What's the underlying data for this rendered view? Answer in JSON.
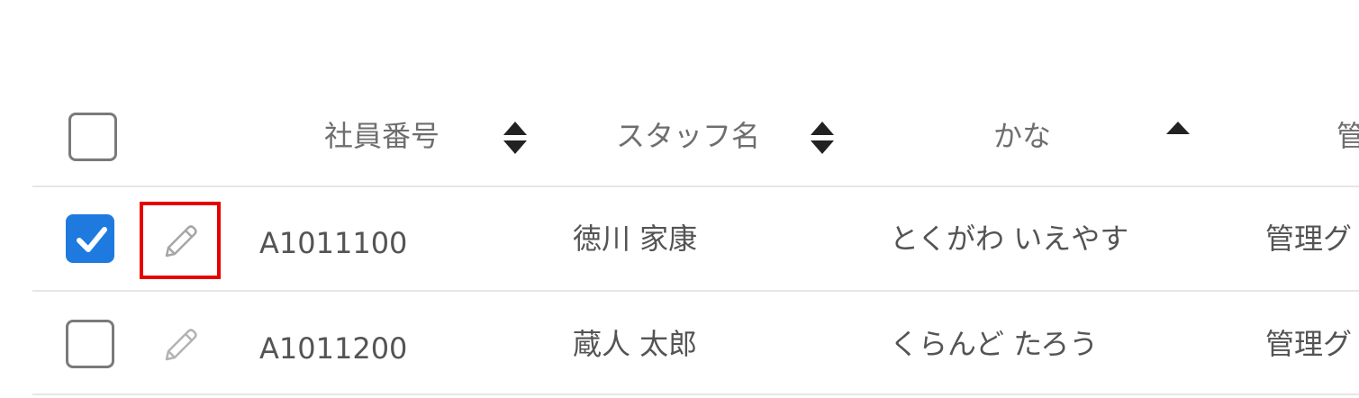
{
  "header": {
    "select_all_checked": false,
    "columns": [
      {
        "label": "社員番号",
        "sort": "both-icon"
      },
      {
        "label": "スタッフ名",
        "sort": "both-icon"
      },
      {
        "label": "かな",
        "sort": "ascending-icon"
      },
      {
        "label": "管"
      }
    ]
  },
  "rows": [
    {
      "checked": true,
      "edit_icon": "pencil-icon",
      "employee_id": "A1011100",
      "staff_name": "徳川 家康",
      "kana": "とくがわ いえやす",
      "group": "管理グ",
      "highlighted": true
    },
    {
      "checked": false,
      "edit_icon": "pencil-icon",
      "employee_id": "A1011200",
      "staff_name": "蔵人 太郎",
      "kana": "くらんど たろう",
      "group": "管理グ",
      "highlighted": false
    }
  ],
  "colors": {
    "checkbox_checked": "#1f7ae0",
    "highlight": "#e60000",
    "divider": "#e6e6e6"
  }
}
